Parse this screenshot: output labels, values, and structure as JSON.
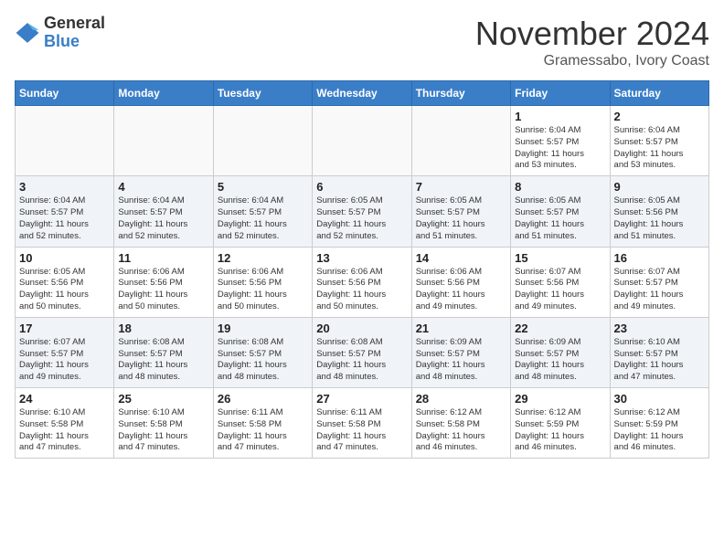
{
  "logo": {
    "general": "General",
    "blue": "Blue"
  },
  "header": {
    "month": "November 2024",
    "location": "Gramessabo, Ivory Coast"
  },
  "weekdays": [
    "Sunday",
    "Monday",
    "Tuesday",
    "Wednesday",
    "Thursday",
    "Friday",
    "Saturday"
  ],
  "weeks": [
    [
      {
        "day": "",
        "content": ""
      },
      {
        "day": "",
        "content": ""
      },
      {
        "day": "",
        "content": ""
      },
      {
        "day": "",
        "content": ""
      },
      {
        "day": "",
        "content": ""
      },
      {
        "day": "1",
        "content": "Sunrise: 6:04 AM\nSunset: 5:57 PM\nDaylight: 11 hours\nand 53 minutes."
      },
      {
        "day": "2",
        "content": "Sunrise: 6:04 AM\nSunset: 5:57 PM\nDaylight: 11 hours\nand 53 minutes."
      }
    ],
    [
      {
        "day": "3",
        "content": "Sunrise: 6:04 AM\nSunset: 5:57 PM\nDaylight: 11 hours\nand 52 minutes."
      },
      {
        "day": "4",
        "content": "Sunrise: 6:04 AM\nSunset: 5:57 PM\nDaylight: 11 hours\nand 52 minutes."
      },
      {
        "day": "5",
        "content": "Sunrise: 6:04 AM\nSunset: 5:57 PM\nDaylight: 11 hours\nand 52 minutes."
      },
      {
        "day": "6",
        "content": "Sunrise: 6:05 AM\nSunset: 5:57 PM\nDaylight: 11 hours\nand 52 minutes."
      },
      {
        "day": "7",
        "content": "Sunrise: 6:05 AM\nSunset: 5:57 PM\nDaylight: 11 hours\nand 51 minutes."
      },
      {
        "day": "8",
        "content": "Sunrise: 6:05 AM\nSunset: 5:57 PM\nDaylight: 11 hours\nand 51 minutes."
      },
      {
        "day": "9",
        "content": "Sunrise: 6:05 AM\nSunset: 5:56 PM\nDaylight: 11 hours\nand 51 minutes."
      }
    ],
    [
      {
        "day": "10",
        "content": "Sunrise: 6:05 AM\nSunset: 5:56 PM\nDaylight: 11 hours\nand 50 minutes."
      },
      {
        "day": "11",
        "content": "Sunrise: 6:06 AM\nSunset: 5:56 PM\nDaylight: 11 hours\nand 50 minutes."
      },
      {
        "day": "12",
        "content": "Sunrise: 6:06 AM\nSunset: 5:56 PM\nDaylight: 11 hours\nand 50 minutes."
      },
      {
        "day": "13",
        "content": "Sunrise: 6:06 AM\nSunset: 5:56 PM\nDaylight: 11 hours\nand 50 minutes."
      },
      {
        "day": "14",
        "content": "Sunrise: 6:06 AM\nSunset: 5:56 PM\nDaylight: 11 hours\nand 49 minutes."
      },
      {
        "day": "15",
        "content": "Sunrise: 6:07 AM\nSunset: 5:56 PM\nDaylight: 11 hours\nand 49 minutes."
      },
      {
        "day": "16",
        "content": "Sunrise: 6:07 AM\nSunset: 5:57 PM\nDaylight: 11 hours\nand 49 minutes."
      }
    ],
    [
      {
        "day": "17",
        "content": "Sunrise: 6:07 AM\nSunset: 5:57 PM\nDaylight: 11 hours\nand 49 minutes."
      },
      {
        "day": "18",
        "content": "Sunrise: 6:08 AM\nSunset: 5:57 PM\nDaylight: 11 hours\nand 48 minutes."
      },
      {
        "day": "19",
        "content": "Sunrise: 6:08 AM\nSunset: 5:57 PM\nDaylight: 11 hours\nand 48 minutes."
      },
      {
        "day": "20",
        "content": "Sunrise: 6:08 AM\nSunset: 5:57 PM\nDaylight: 11 hours\nand 48 minutes."
      },
      {
        "day": "21",
        "content": "Sunrise: 6:09 AM\nSunset: 5:57 PM\nDaylight: 11 hours\nand 48 minutes."
      },
      {
        "day": "22",
        "content": "Sunrise: 6:09 AM\nSunset: 5:57 PM\nDaylight: 11 hours\nand 48 minutes."
      },
      {
        "day": "23",
        "content": "Sunrise: 6:10 AM\nSunset: 5:57 PM\nDaylight: 11 hours\nand 47 minutes."
      }
    ],
    [
      {
        "day": "24",
        "content": "Sunrise: 6:10 AM\nSunset: 5:58 PM\nDaylight: 11 hours\nand 47 minutes."
      },
      {
        "day": "25",
        "content": "Sunrise: 6:10 AM\nSunset: 5:58 PM\nDaylight: 11 hours\nand 47 minutes."
      },
      {
        "day": "26",
        "content": "Sunrise: 6:11 AM\nSunset: 5:58 PM\nDaylight: 11 hours\nand 47 minutes."
      },
      {
        "day": "27",
        "content": "Sunrise: 6:11 AM\nSunset: 5:58 PM\nDaylight: 11 hours\nand 47 minutes."
      },
      {
        "day": "28",
        "content": "Sunrise: 6:12 AM\nSunset: 5:58 PM\nDaylight: 11 hours\nand 46 minutes."
      },
      {
        "day": "29",
        "content": "Sunrise: 6:12 AM\nSunset: 5:59 PM\nDaylight: 11 hours\nand 46 minutes."
      },
      {
        "day": "30",
        "content": "Sunrise: 6:12 AM\nSunset: 5:59 PM\nDaylight: 11 hours\nand 46 minutes."
      }
    ]
  ]
}
